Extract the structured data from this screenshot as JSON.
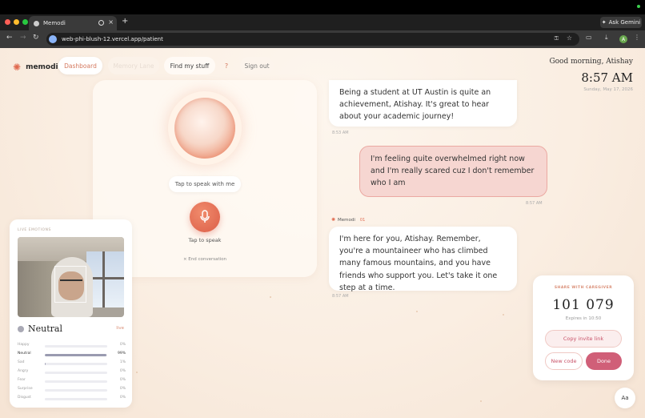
{
  "browser": {
    "tab_title": "Memodi",
    "new_tab": "+",
    "tab_close": "×",
    "ask_gemini": "Ask Gemini",
    "url": "web-phi-blush-12.vercel.app/patient",
    "profile_initial": "A"
  },
  "app": {
    "brand": "memodi",
    "nav": {
      "dashboard": "Dashboard",
      "memory_lane": "Memory Lane",
      "find_my_stuff": "Find my stuff",
      "help": "?",
      "sign_out": "Sign out"
    },
    "greeting": "Good morning, Atishay",
    "time": "8:57 AM",
    "date": "Sunday, May 17, 2026"
  },
  "voice": {
    "prompt": "Tap to speak with me",
    "tap_label": "Tap to speak",
    "end_conversation": "× End conversation"
  },
  "emotions": {
    "header": "LIVE EMOTIONS",
    "current": "Neutral",
    "live_label": "live",
    "rows": [
      {
        "label": "Happy",
        "pct": "0%",
        "value": 0
      },
      {
        "label": "Neutral",
        "pct": "99%",
        "value": 99
      },
      {
        "label": "Sad",
        "pct": "1%",
        "value": 1
      },
      {
        "label": "Angry",
        "pct": "0%",
        "value": 0
      },
      {
        "label": "Fear",
        "pct": "0%",
        "value": 0
      },
      {
        "label": "Surprise",
        "pct": "0%",
        "value": 0
      },
      {
        "label": "Disgust",
        "pct": "0%",
        "value": 0
      }
    ]
  },
  "chat": {
    "messages": [
      {
        "role": "assistant",
        "text": "Being a student at UT Austin is quite an achievement, Atishay. It's great to hear about your academic journey!",
        "time": "8:53 AM"
      },
      {
        "role": "user",
        "text": "I'm feeling quite overwhelmed right now and I'm really scared cuz I don't remember who I am",
        "time": "8:57 AM"
      },
      {
        "role": "assistant",
        "sender": "Memodi",
        "badge": "01",
        "text": "I'm here for you, Atishay. Remember, you're a mountaineer who has climbed many famous mountains, and you have friends who support you. Let's take it one step at a time.",
        "time": "8:57 AM"
      }
    ]
  },
  "share": {
    "header": "SHARE WITH CAREGIVER",
    "code": "101 079",
    "expires": "Expires in 10:50",
    "copy_label": "Copy invite link",
    "new_code_label": "New code",
    "done_label": "Done"
  },
  "text_size_button": "Aa",
  "colors": {
    "accent": "#e06a4f",
    "pink": "#d05f78",
    "user_bubble": "#f6d6d1"
  }
}
